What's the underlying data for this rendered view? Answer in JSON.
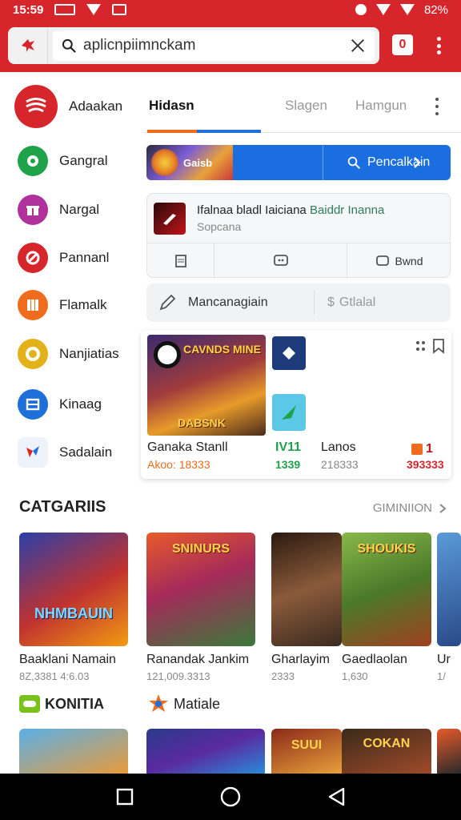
{
  "status_bar": {
    "time": "15:59",
    "battery": "82%"
  },
  "app_bar": {
    "search_value": "aplicnpiimnckam",
    "tab_count": "0",
    "brand_color": "#d7262b"
  },
  "sidebar": {
    "items": [
      {
        "label": "Adaakan",
        "icon": "radio-waves-icon",
        "color": "#d7262b"
      },
      {
        "label": "Gangral",
        "icon": "chat-bubble-icon",
        "color": "#1ea34a"
      },
      {
        "label": "Nargal",
        "icon": "gift-icon",
        "color": "#b0309c"
      },
      {
        "label": "Pannanl",
        "icon": "wrench-icon",
        "color": "#d7262b"
      },
      {
        "label": "Flamalk",
        "icon": "grid-icon",
        "color": "#ef6c1e"
      },
      {
        "label": "Nanjiatias",
        "icon": "ring-icon",
        "color": "#e3b21a"
      },
      {
        "label": "Kinaag",
        "icon": "window-icon",
        "color": "#1f6fd8"
      },
      {
        "label": "Sadalain",
        "icon": "puzzle-icon",
        "color": "#1f6fd8"
      }
    ]
  },
  "tabs": {
    "items": [
      "Hidasn",
      "Slagen",
      "Hamgun"
    ],
    "active": 0
  },
  "promo": {
    "art_text": "Gaisb",
    "search_label": "Pencalkain"
  },
  "notification": {
    "title_plain": "Ifalnaa bladl Iaiciana ",
    "title_highlight": "Baiddr Inanna",
    "subtitle": "Sopcana",
    "action_label": "Bwnd"
  },
  "manage": {
    "left_label": "Mancanagiain",
    "right_label": "Gtlalal"
  },
  "featured": {
    "main_title": "CAVNDS MINE",
    "main_subtitle": "DABSNK",
    "items": [
      {
        "name": "Ganaka Stanll",
        "value": "Akoo: 18333",
        "value_color": "#ef6c1e"
      },
      {
        "name": "IV11",
        "value": "1339",
        "value_color": "#1ea34a"
      },
      {
        "name": "Lanos",
        "value": "218333",
        "value_color": "#888888"
      },
      {
        "name": "1",
        "value": "393333",
        "value_color": "#d7262b"
      }
    ]
  },
  "categories": {
    "title": "CATGARIIS",
    "more_label": "GIMINIION",
    "games": [
      {
        "title": "NHMBAUIN",
        "name": "Baaklani Namain",
        "count": "8Z,3381 4:6.03"
      },
      {
        "title": "SNINURS",
        "name": "Ranandak Jankim",
        "count": "121,009.3313"
      },
      {
        "title": "",
        "name": "Gharlayim",
        "count": "2333"
      },
      {
        "title": "SHOUKIS",
        "name": "Gaedlaolan",
        "count": "1,630"
      },
      {
        "title": "",
        "name": "Ur",
        "count": "1/"
      }
    ]
  },
  "sections": [
    {
      "label": "KONITIA",
      "icon": "gamepad-icon",
      "color": "#7bc11c"
    },
    {
      "label": "Matiale",
      "icon": "star-burst-icon",
      "color": "#ef6c1e"
    }
  ],
  "bottom_thumbs": [
    {
      "text": ""
    },
    {
      "text": ""
    },
    {
      "text": "SUUI"
    },
    {
      "text": "COKAN"
    }
  ]
}
